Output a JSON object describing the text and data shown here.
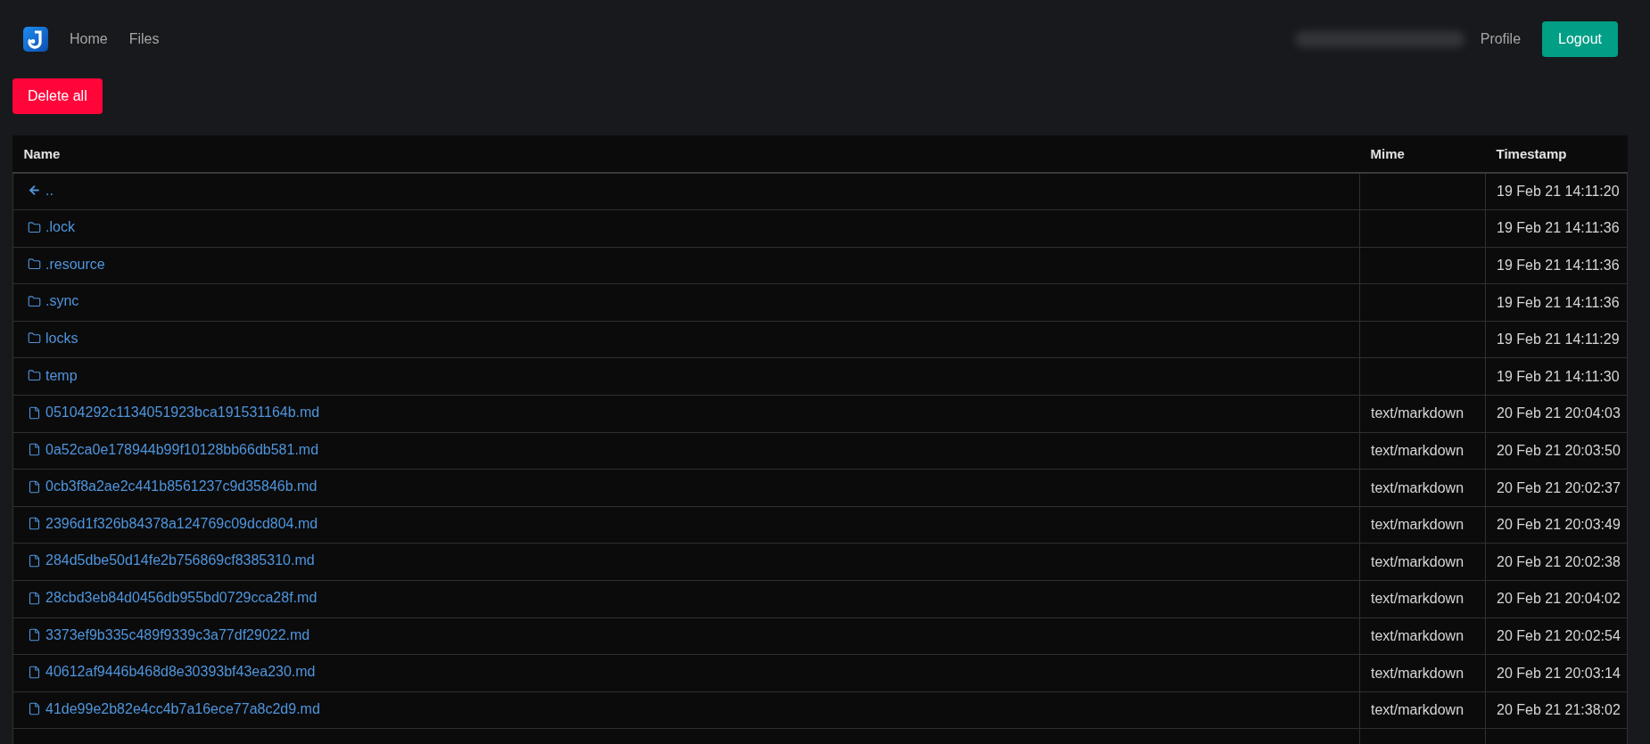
{
  "navbar": {
    "links": [
      "Home",
      "Files"
    ],
    "account_blurred": true,
    "profile_link": "Profile",
    "logout_button": "Logout"
  },
  "toolbar": {
    "delete_all_button": "Delete all"
  },
  "table": {
    "columns": [
      "Name",
      "Mime",
      "Timestamp"
    ],
    "rows": [
      {
        "kind": "parent",
        "name": "..",
        "timestamp": "19 Feb 21 14:11:20"
      },
      {
        "kind": "folder",
        "name": ".lock",
        "timestamp": "19 Feb 21 14:11:36"
      },
      {
        "kind": "folder",
        "name": ".resource",
        "timestamp": "19 Feb 21 14:11:36"
      },
      {
        "kind": "folder",
        "name": ".sync",
        "timestamp": "19 Feb 21 14:11:36"
      },
      {
        "kind": "folder",
        "name": "locks",
        "timestamp": "19 Feb 21 14:11:29"
      },
      {
        "kind": "folder",
        "name": "temp",
        "timestamp": "19 Feb 21 14:11:30"
      },
      {
        "kind": "file",
        "name": "05104292c1134051923bca191531164b.md",
        "mime": "text/markdown",
        "timestamp": "20 Feb 21 20:04:03"
      },
      {
        "kind": "file",
        "name": "0a52ca0e178944b99f10128bb66db581.md",
        "mime": "text/markdown",
        "timestamp": "20 Feb 21 20:03:50"
      },
      {
        "kind": "file",
        "name": "0cb3f8a2ae2c441b8561237c9d35846b.md",
        "mime": "text/markdown",
        "timestamp": "20 Feb 21 20:02:37"
      },
      {
        "kind": "file",
        "name": "2396d1f326b84378a124769c09dcd804.md",
        "mime": "text/markdown",
        "timestamp": "20 Feb 21 20:03:49"
      },
      {
        "kind": "file",
        "name": "284d5dbe50d14fe2b756869cf8385310.md",
        "mime": "text/markdown",
        "timestamp": "20 Feb 21 20:02:38"
      },
      {
        "kind": "file",
        "name": "28cbd3eb84d0456db955bd0729cca28f.md",
        "mime": "text/markdown",
        "timestamp": "20 Feb 21 20:04:02"
      },
      {
        "kind": "file",
        "name": "3373ef9b335c489f9339c3a77df29022.md",
        "mime": "text/markdown",
        "timestamp": "20 Feb 21 20:02:54"
      },
      {
        "kind": "file",
        "name": "40612af9446b468d8e30393bf43ea230.md",
        "mime": "text/markdown",
        "timestamp": "20 Feb 21 20:03:14"
      },
      {
        "kind": "file",
        "name": "41de99e2b82e4cc4b7a16ece77a8c2d9.md",
        "mime": "text/markdown",
        "timestamp": "20 Feb 21 21:38:02"
      }
    ]
  }
}
